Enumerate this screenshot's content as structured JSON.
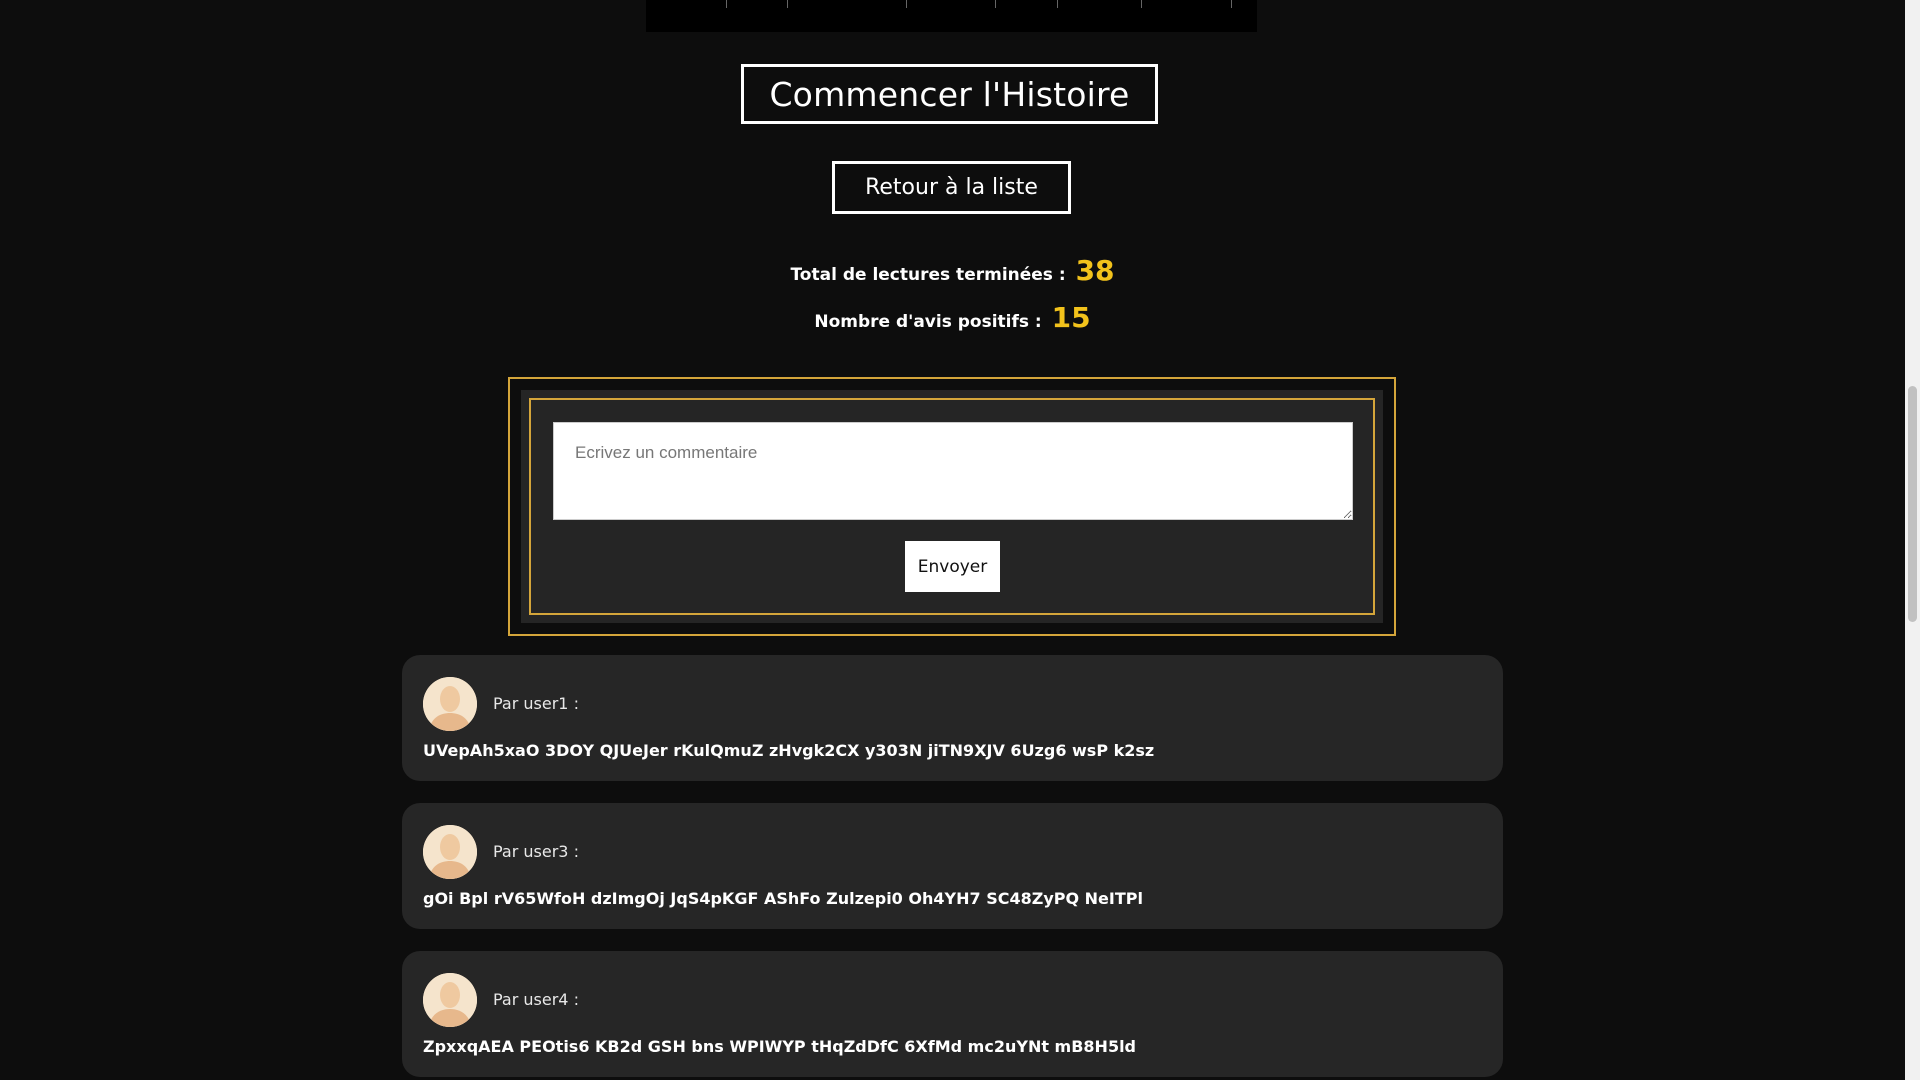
{
  "actions": {
    "start_story_label": "Commencer l'Histoire",
    "back_to_list_label": "Retour à la liste"
  },
  "stats": {
    "reads_label": "Total de lectures terminées :",
    "reads_value": "38",
    "positive_label": "Nombre d'avis positifs :",
    "positive_value": "15"
  },
  "comment_form": {
    "placeholder": "Ecrivez un commentaire",
    "value": "",
    "send_label": "Envoyer"
  },
  "comments": [
    {
      "author": "Par user1 :",
      "text": "UVepAh5xaO 3DOY QJUeJer rKulQmuZ zHvgk2CX y303N jiTN9XJV 6Uzg6 wsP k2sz"
    },
    {
      "author": "Par user3 :",
      "text": "gOi Bpl rV65WfoH dzImgOj JqS4pKGF AShFo Zulzepi0 Oh4YH7 SC48ZyPQ NeITPl"
    },
    {
      "author": "Par user4 :",
      "text": "ZpxxqAEA PEOtis6 KB2d GSH bns WPIWYP tHqZdDfC 6XfMd mc2uYNt mB8H5ld"
    }
  ],
  "colors": {
    "background": "#0d0d0d",
    "accent_gold": "#d4a53a",
    "stat_yellow": "#f2c21b",
    "card_bg": "#262626"
  },
  "icons": {
    "avatar": "user-avatar-icon"
  }
}
